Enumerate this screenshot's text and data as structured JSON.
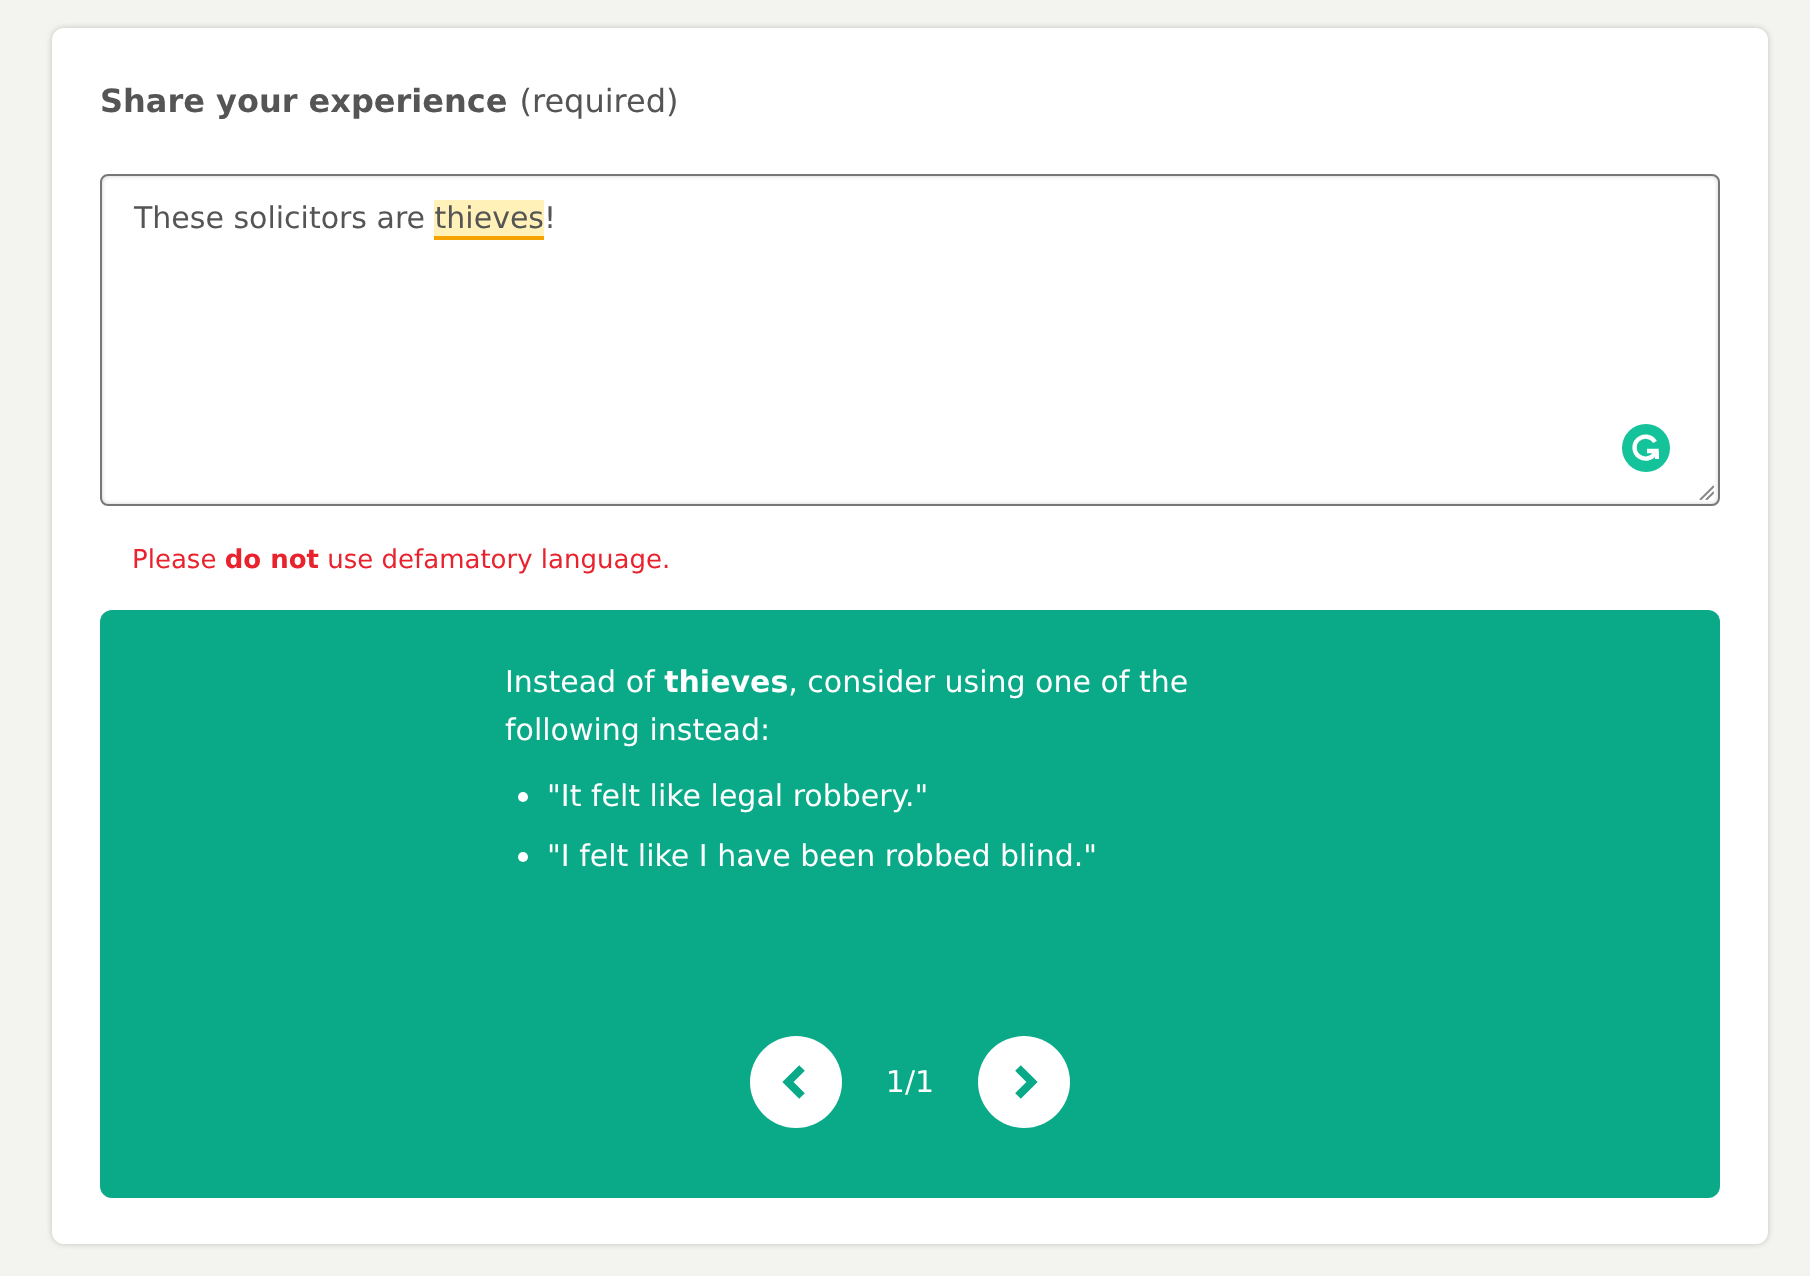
{
  "heading": {
    "title": "Share your experience",
    "note": "(required)"
  },
  "field": {
    "parts": [
      {
        "text": "These solicitors are ",
        "flagged": false
      },
      {
        "text": "thieves",
        "flagged": true
      },
      {
        "text": "!",
        "flagged": false
      }
    ]
  },
  "error": "Please **do not** use defamatory language.",
  "suggestion": {
    "intro": "Instead of **thieves**, consider using one of the following instead:",
    "options": [
      "\"It felt like legal robbery.\"",
      "\"I felt like I have been robbed blind.\""
    ],
    "pager": "1/1"
  }
}
